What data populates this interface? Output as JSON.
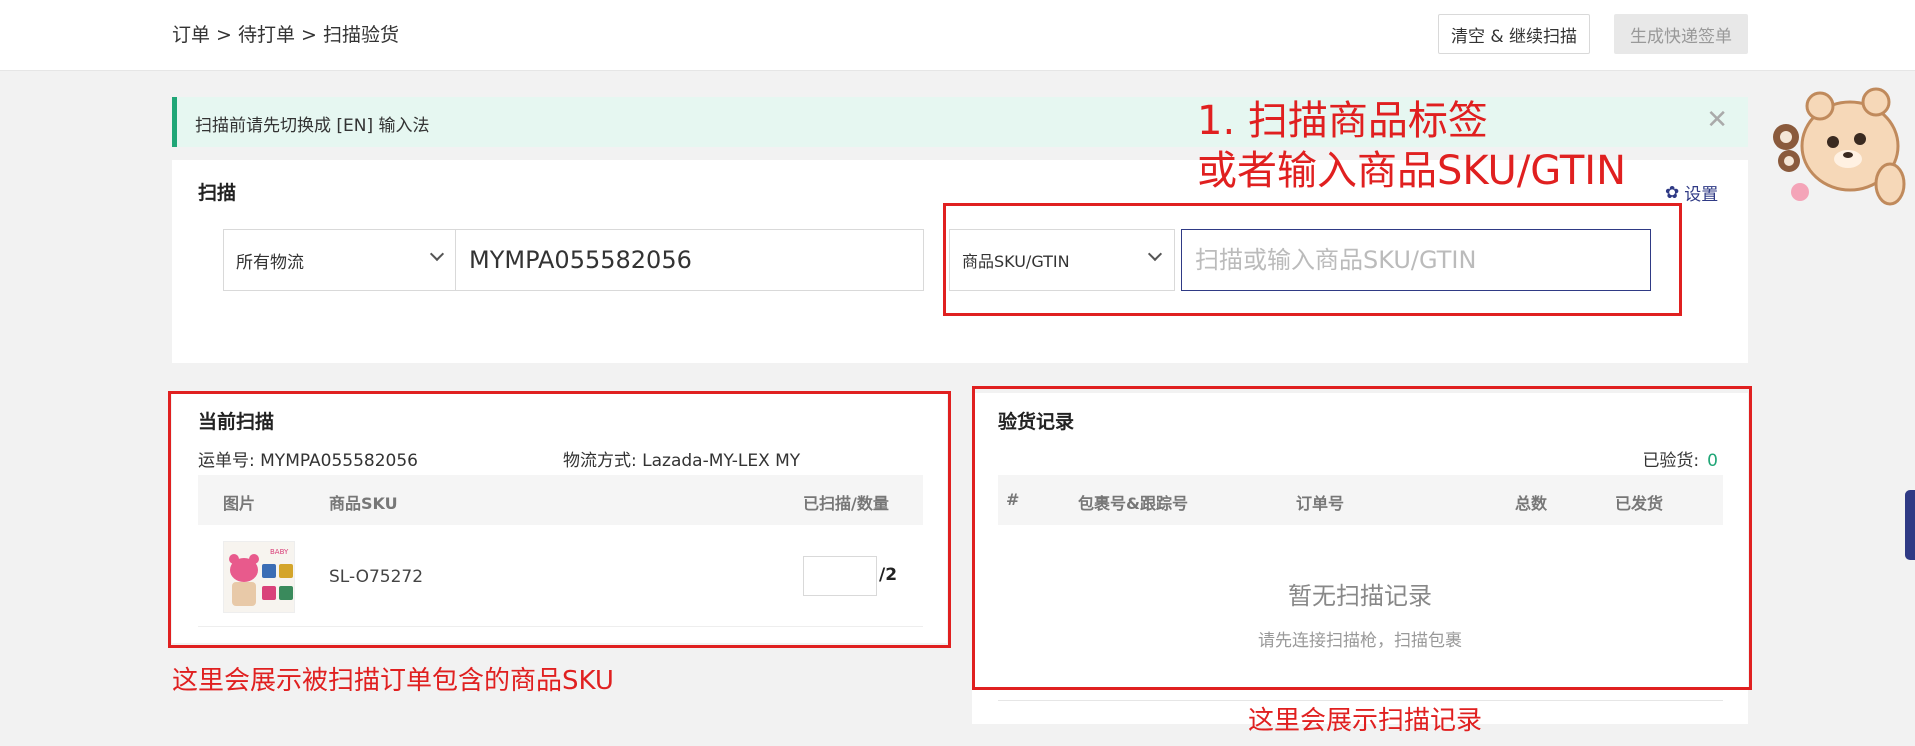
{
  "header": {
    "breadcrumb": "订单 > 待打单 > 扫描验货",
    "clear_button": "清空 & 继续扫描",
    "generate_button": "生成快递签单"
  },
  "notice": {
    "text": "扫描前请先切换成 [EN] 输入法",
    "close": "✕"
  },
  "scan": {
    "title": "扫描",
    "settings_label": "设置",
    "logistics_select": "所有物流",
    "order_input_value": "MYMPA055582056",
    "sku_type_select": "商品SKU/GTIN",
    "sku_input_placeholder": "扫描或输入商品SKU/GTIN"
  },
  "current": {
    "title": "当前扫描",
    "tracking_label": "运单号: ",
    "tracking_value": "MYMPA055582056",
    "method_label": "物流方式: ",
    "method_value": "Lazada-MY-LEX MY",
    "columns": [
      "图片",
      "商品SKU",
      "已扫描/数量"
    ],
    "rows": [
      {
        "sku": "SL-O75272",
        "scanned": "",
        "total": "/2"
      }
    ]
  },
  "records": {
    "title": "验货记录",
    "checked_label": "已验货:",
    "checked_count": "0",
    "columns": [
      "#",
      "包裹号&跟踪号",
      "订单号",
      "总数",
      "已发货"
    ],
    "empty_title": "暂无扫描记录",
    "empty_hint": "请先连接扫描枪，扫描包裹"
  },
  "annotations": {
    "scan_tip_line1": "1. 扫描商品标签",
    "scan_tip_line2": "或者输入商品SKU/GTIN",
    "current_tip": "这里会展示被扫描订单包含的商品SKU",
    "records_tip": "这里会展示扫描记录"
  },
  "colors": {
    "accent": "#2f3a85",
    "success": "#20a677",
    "annotation": "#e02020"
  }
}
